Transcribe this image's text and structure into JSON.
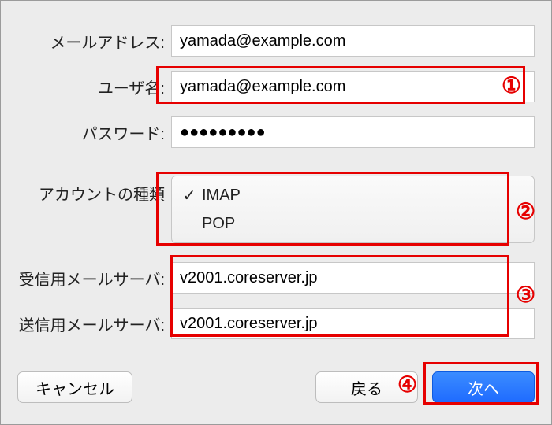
{
  "fields": {
    "email_label": "メールアドレス:",
    "email_value": "yamada@example.com",
    "user_label": "ユーザ名:",
    "user_value": "yamada@example.com",
    "password_label": "パスワード:",
    "password_value": "●●●●●●●●●",
    "account_type_label": "アカウントの種類",
    "incoming_label": "受信用メールサーバ:",
    "incoming_value": "v2001.coreserver.jp",
    "outgoing_label": "送信用メールサーバ:",
    "outgoing_value": "v2001.coreserver.jp"
  },
  "account_type": {
    "selected": "IMAP",
    "options": [
      "IMAP",
      "POP"
    ]
  },
  "buttons": {
    "cancel": "キャンセル",
    "back": "戻る",
    "next": "次へ"
  },
  "annotations": {
    "n1": "①",
    "n2": "②",
    "n3": "③",
    "n4": "④"
  },
  "colors": {
    "annotation": "#e60000",
    "primary": "#1f6bff"
  }
}
